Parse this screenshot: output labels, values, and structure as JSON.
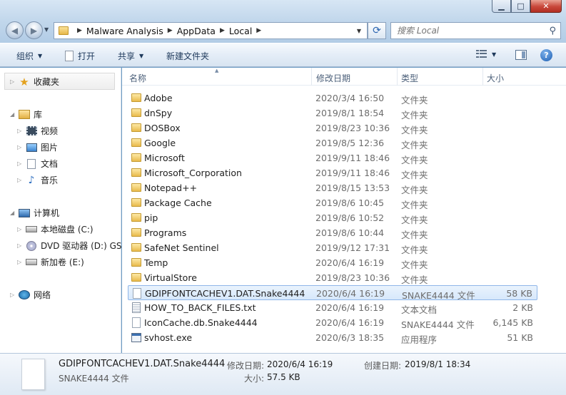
{
  "window": {
    "min_icon": "minimize-icon",
    "max_icon": "maximize-icon",
    "close_icon": "close-icon"
  },
  "address": {
    "crumbs": [
      "Malware Analysis",
      "AppData",
      "Local"
    ]
  },
  "search": {
    "placeholder": "搜索 Local"
  },
  "toolbar": {
    "organize": "组织",
    "open": "打开",
    "share": "共享",
    "new_folder": "新建文件夹"
  },
  "nav": {
    "favorites": "收藏夹",
    "libraries": "库",
    "videos": "视频",
    "pictures": "图片",
    "documents": "文档",
    "music": "音乐",
    "computer": "计算机",
    "local_disk": "本地磁盘 (C:)",
    "dvd": "DVD 驱动器 (D:) GS",
    "new_volume": "新加卷 (E:)",
    "network": "网络"
  },
  "columns": {
    "name": "名称",
    "modified": "修改日期",
    "type": "类型",
    "size": "大小"
  },
  "files": [
    {
      "name": "Adobe",
      "date": "2020/3/4 16:50",
      "type": "文件夹",
      "size": "",
      "icon": "folder"
    },
    {
      "name": "dnSpy",
      "date": "2019/8/1 18:54",
      "type": "文件夹",
      "size": "",
      "icon": "folder"
    },
    {
      "name": "DOSBox",
      "date": "2019/8/23 10:36",
      "type": "文件夹",
      "size": "",
      "icon": "folder"
    },
    {
      "name": "Google",
      "date": "2019/8/5 12:36",
      "type": "文件夹",
      "size": "",
      "icon": "folder"
    },
    {
      "name": "Microsoft",
      "date": "2019/9/11 18:46",
      "type": "文件夹",
      "size": "",
      "icon": "folder"
    },
    {
      "name": "Microsoft_Corporation",
      "date": "2019/9/11 18:46",
      "type": "文件夹",
      "size": "",
      "icon": "folder"
    },
    {
      "name": "Notepad++",
      "date": "2019/8/15 13:53",
      "type": "文件夹",
      "size": "",
      "icon": "folder"
    },
    {
      "name": "Package Cache",
      "date": "2019/8/6 10:45",
      "type": "文件夹",
      "size": "",
      "icon": "folder"
    },
    {
      "name": "pip",
      "date": "2019/8/6 10:52",
      "type": "文件夹",
      "size": "",
      "icon": "folder"
    },
    {
      "name": "Programs",
      "date": "2019/8/6 10:44",
      "type": "文件夹",
      "size": "",
      "icon": "folder"
    },
    {
      "name": "SafeNet Sentinel",
      "date": "2019/9/12 17:31",
      "type": "文件夹",
      "size": "",
      "icon": "folder"
    },
    {
      "name": "Temp",
      "date": "2020/6/4 16:19",
      "type": "文件夹",
      "size": "",
      "icon": "folder"
    },
    {
      "name": "VirtualStore",
      "date": "2019/8/23 10:36",
      "type": "文件夹",
      "size": "",
      "icon": "folder"
    },
    {
      "name": "GDIPFONTCACHEV1.DAT.Snake4444",
      "date": "2020/6/4 16:19",
      "type": "SNAKE4444 文件",
      "size": "58 KB",
      "icon": "file",
      "selected": true
    },
    {
      "name": "HOW_TO_BACK_FILES.txt",
      "date": "2020/6/4 16:19",
      "type": "文本文档",
      "size": "2 KB",
      "icon": "txt"
    },
    {
      "name": "IconCache.db.Snake4444",
      "date": "2020/6/4 16:19",
      "type": "SNAKE4444 文件",
      "size": "6,145 KB",
      "icon": "file"
    },
    {
      "name": "svhost.exe",
      "date": "2020/6/3 18:35",
      "type": "应用程序",
      "size": "51 KB",
      "icon": "exe"
    }
  ],
  "details": {
    "name": "GDIPFONTCACHEV1.DAT.Snake4444",
    "type": "SNAKE4444 文件",
    "modified_label": "修改日期:",
    "modified_value": "2020/6/4 16:19",
    "created_label": "创建日期:",
    "created_value": "2019/8/1 18:34",
    "size_label": "大小:",
    "size_value": "57.5 KB"
  }
}
